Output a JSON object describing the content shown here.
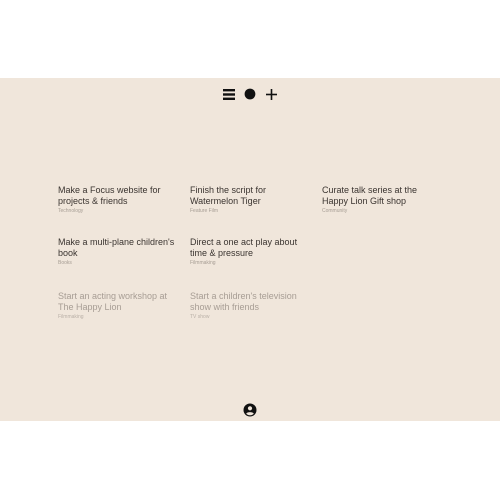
{
  "toolbar": {
    "icons": [
      "menu-icon",
      "circle-icon",
      "plus-icon"
    ]
  },
  "projects": [
    {
      "title": "Make a Focus website for projects & friends",
      "tag": "Technology",
      "faded": false
    },
    {
      "title": "Finish the script for Watermelon Tiger",
      "tag": "Feature Film",
      "faded": false
    },
    {
      "title": "Curate talk series at the Happy Lion Gift shop",
      "tag": "Community",
      "faded": false
    },
    {
      "title": "Make a multi-plane children's book",
      "tag": "Books",
      "faded": false
    },
    {
      "title": "Direct a one act play about time & pressure",
      "tag": "Filmmaking",
      "faded": false
    },
    {
      "title": "Start an acting workshop at The Happy Lion",
      "tag": "Filmmaking",
      "faded": true
    },
    {
      "title": "Start a children's television show with friends",
      "tag": "TV show",
      "faded": true
    }
  ],
  "footer": {
    "icon": "user-icon"
  },
  "colors": {
    "background": "#f0e6db",
    "text": "#3a3430",
    "muted": "#a69d94"
  }
}
